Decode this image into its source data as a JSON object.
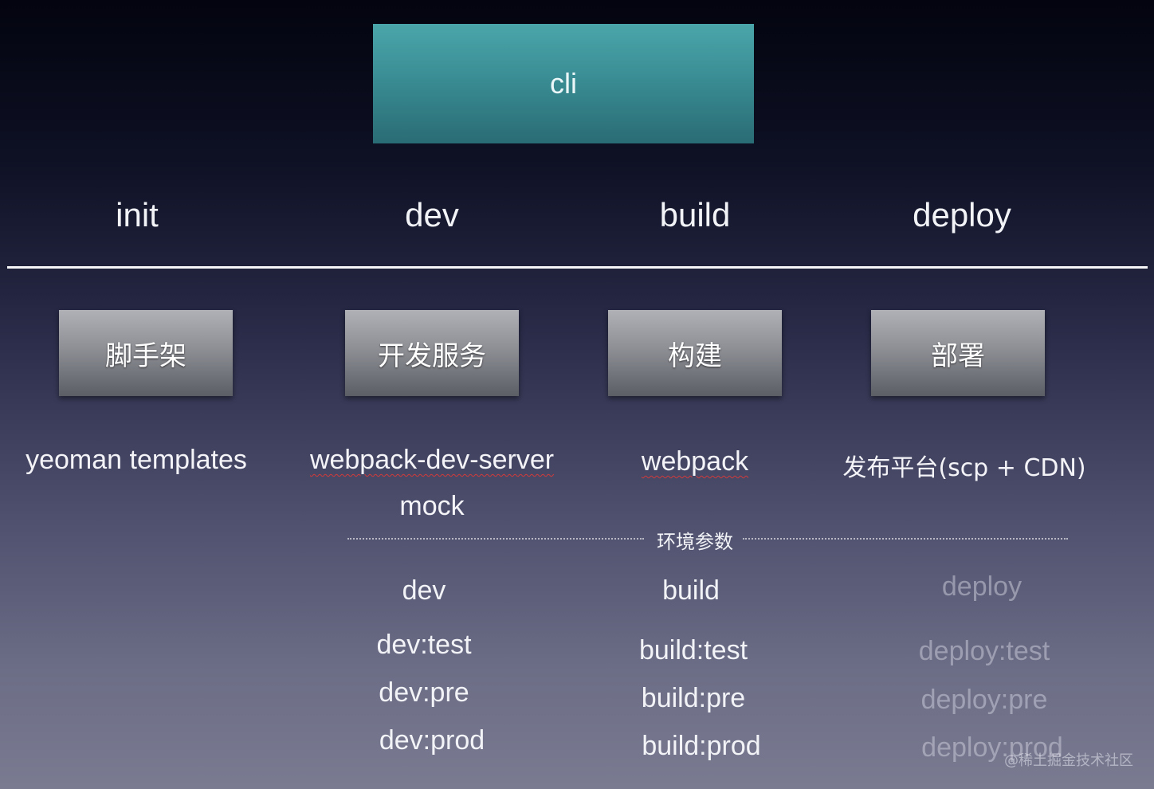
{
  "cli": {
    "label": "cli"
  },
  "phases": [
    "init",
    "dev",
    "build",
    "deploy"
  ],
  "tools": [
    "脚手架",
    "开发服务",
    "构建",
    "部署"
  ],
  "descriptions": {
    "init": "yeoman templates",
    "dev": [
      "webpack-dev-server",
      "mock"
    ],
    "build": "webpack",
    "deploy": "发布平台(scp + CDN)"
  },
  "env_label": "环境参数",
  "commands": {
    "dev": [
      "dev",
      "dev:test",
      "dev:pre",
      "dev:prod"
    ],
    "build": [
      "build",
      "build:test",
      "build:pre",
      "build:prod"
    ],
    "deploy": [
      "deploy",
      "deploy:test",
      "deploy:pre",
      "deploy:prod"
    ]
  },
  "watermark": "@稀土掘金技术社区",
  "colors": {
    "cli_box": "#3a8d94",
    "tool_box": "#8d8f95",
    "divider": "#f5f5f7",
    "faded_text": "#c8c9d7"
  }
}
